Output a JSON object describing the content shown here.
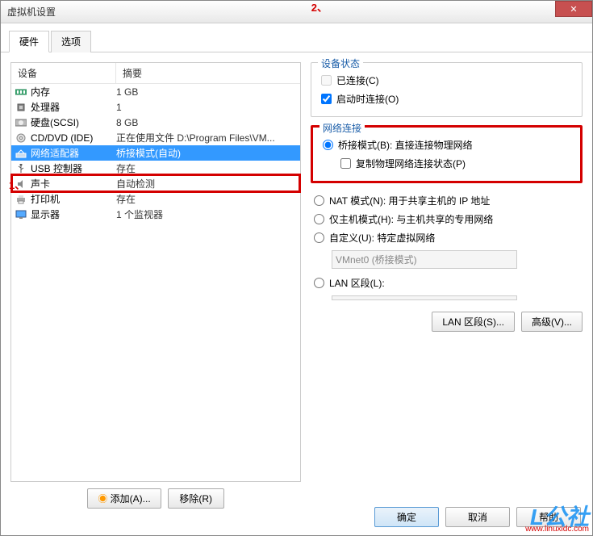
{
  "window": {
    "title": "虚拟机设置"
  },
  "tabs": {
    "hardware": "硬件",
    "options": "选项"
  },
  "columns": {
    "device": "设备",
    "summary": "摘要"
  },
  "devices": [
    {
      "name": "内存",
      "summary": "1 GB",
      "icon": "ram"
    },
    {
      "name": "处理器",
      "summary": "1",
      "icon": "cpu"
    },
    {
      "name": "硬盘(SCSI)",
      "summary": "8 GB",
      "icon": "hdd"
    },
    {
      "name": "CD/DVD (IDE)",
      "summary": "正在使用文件 D:\\Program Files\\VM...",
      "icon": "cd"
    },
    {
      "name": "网络适配器",
      "summary": "桥接模式(自动)",
      "icon": "net",
      "selected": true
    },
    {
      "name": "USB 控制器",
      "summary": "存在",
      "icon": "usb"
    },
    {
      "name": "声卡",
      "summary": "自动检测",
      "icon": "snd"
    },
    {
      "name": "打印机",
      "summary": "存在",
      "icon": "prn"
    },
    {
      "name": "显示器",
      "summary": "1 个监视器",
      "icon": "dsp"
    }
  ],
  "annotations": {
    "one": "1、",
    "two": "2、"
  },
  "left_buttons": {
    "add": "添加(A)...",
    "remove": "移除(R)"
  },
  "status_group": {
    "title": "设备状态",
    "connected": "已连接(C)",
    "connect_on_start": "启动时连接(O)"
  },
  "net_group": {
    "title": "网络连接",
    "bridged": "桥接模式(B): 直接连接物理网络",
    "replicate": "复制物理网络连接状态(P)",
    "nat": "NAT 模式(N): 用于共享主机的 IP 地址",
    "hostonly": "仅主机模式(H): 与主机共享的专用网络",
    "custom": "自定义(U): 特定虚拟网络",
    "custom_value": "VMnet0 (桥接模式)",
    "lanseg": "LAN 区段(L):",
    "lanseg_value": ""
  },
  "right_buttons": {
    "lan": "LAN 区段(S)...",
    "adv": "高级(V)..."
  },
  "footer": {
    "ok": "确定",
    "cancel": "取消",
    "help": "帮助"
  },
  "watermark": {
    "logo": "L公社",
    "url": "www.linuxidc.com"
  }
}
